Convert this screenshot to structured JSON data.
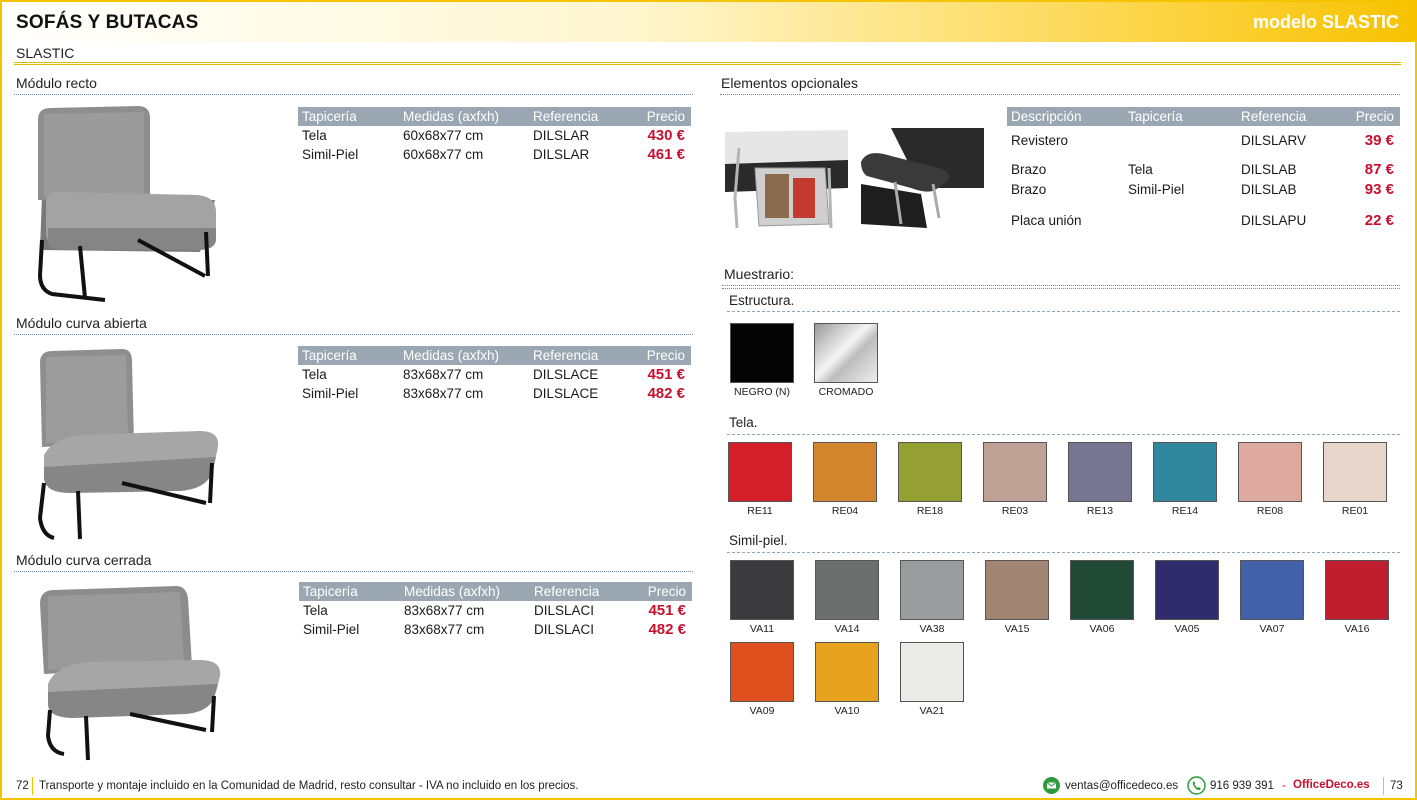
{
  "header": {
    "title": "SOFÁS Y BUTACAS",
    "model": "modelo SLASTIC",
    "subtitle": "SLASTIC"
  },
  "modules": [
    {
      "title": "Módulo recto",
      "columns": [
        "Tapicería",
        "Medidas (axfxh)",
        "Referencia",
        "Precio"
      ],
      "rows": [
        {
          "tapiceria": "Tela",
          "medidas": "60x68x77 cm",
          "referencia": "DILSLAR",
          "precio": "430 €"
        },
        {
          "tapiceria": "Simil-Piel",
          "medidas": "60x68x77 cm",
          "referencia": "DILSLAR",
          "precio": "461 €"
        }
      ]
    },
    {
      "title": "Módulo curva abierta",
      "columns": [
        "Tapicería",
        "Medidas (axfxh)",
        "Referencia",
        "Precio"
      ],
      "rows": [
        {
          "tapiceria": "Tela",
          "medidas": "83x68x77 cm",
          "referencia": "DILSLACE",
          "precio": "451 €"
        },
        {
          "tapiceria": "Simil-Piel",
          "medidas": "83x68x77 cm",
          "referencia": "DILSLACE",
          "precio": "482 €"
        }
      ]
    },
    {
      "title": "Módulo curva cerrada",
      "columns": [
        "Tapicería",
        "Medidas (axfxh)",
        "Referencia",
        "Precio"
      ],
      "rows": [
        {
          "tapiceria": "Tela",
          "medidas": "83x68x77 cm",
          "referencia": "DILSLACI",
          "precio": "451 €"
        },
        {
          "tapiceria": "Simil-Piel",
          "medidas": "83x68x77 cm",
          "referencia": "DILSLACI",
          "precio": "482 €"
        }
      ]
    }
  ],
  "optional": {
    "title": "Elementos opcionales",
    "columns": [
      "Descripción",
      "Tapicería",
      "Referencia",
      "Precio"
    ],
    "rows": [
      {
        "descripcion": "Revistero",
        "tapiceria": "",
        "referencia": "DILSLARV",
        "precio": "39 €"
      },
      {
        "descripcion": "Brazo",
        "tapiceria": "Tela",
        "referencia": "DILSLAB",
        "precio": "87 €"
      },
      {
        "descripcion": "Brazo",
        "tapiceria": "Simil-Piel",
        "referencia": "DILSLAB",
        "precio": "93 €"
      },
      {
        "descripcion": "Placa unión",
        "tapiceria": "",
        "referencia": "DILSLAPU",
        "precio": "22 €"
      }
    ]
  },
  "samples": {
    "title": "Muestrario:",
    "estructura": {
      "title": "Estructura.",
      "items": [
        {
          "code": "NEGRO (N)",
          "color": "#050505"
        },
        {
          "code": "CROMADO",
          "color": "#d8d8d8"
        }
      ]
    },
    "tela": {
      "title": "Tela.",
      "items": [
        {
          "code": "RE11",
          "color": "#d41f2a"
        },
        {
          "code": "RE04",
          "color": "#d4862e"
        },
        {
          "code": "RE18",
          "color": "#94a033"
        },
        {
          "code": "RE03",
          "color": "#bfa295"
        },
        {
          "code": "RE13",
          "color": "#767592"
        },
        {
          "code": "RE14",
          "color": "#30879e"
        },
        {
          "code": "RE08",
          "color": "#deaaa0"
        },
        {
          "code": "RE01",
          "color": "#e6d6cc"
        }
      ]
    },
    "simil": {
      "title": "Simil-piel.",
      "items": [
        {
          "code": "VA11",
          "color": "#3b3a3c"
        },
        {
          "code": "VA14",
          "color": "#6d6f6f"
        },
        {
          "code": "VA38",
          "color": "#9a9c9e"
        },
        {
          "code": "VA15",
          "color": "#9f8572"
        },
        {
          "code": "VA06",
          "color": "#204a35"
        },
        {
          "code": "VA05",
          "color": "#2f2c6c"
        },
        {
          "code": "VA07",
          "color": "#4261a8"
        },
        {
          "code": "VA16",
          "color": "#be1e2d"
        },
        {
          "code": "VA09",
          "color": "#e0501f"
        },
        {
          "code": "VA10",
          "color": "#e7a21e"
        },
        {
          "code": "VA21",
          "color": "#ebebea"
        }
      ]
    }
  },
  "footer": {
    "page_left": "72",
    "legal": "Transporte y montaje incluido en la Comunidad de Madrid, resto consultar - IVA no incluido en los precios.",
    "email": "ventas@officedeco.es",
    "phone": "916 939 391",
    "dash": "-",
    "brand": "OfficeDeco.es",
    "page_right": "73"
  },
  "colors": {
    "accent_yellow": "#f5c400",
    "price_red": "#c8102e",
    "table_header": "#9aa7b2",
    "rule_blue": "#6a8fb0"
  }
}
